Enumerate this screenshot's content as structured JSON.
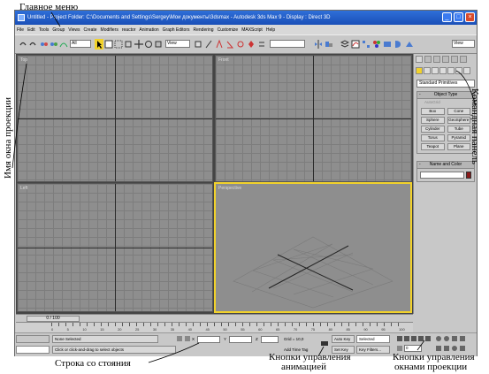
{
  "window": {
    "title": "Untitled   - Project Folder: C:\\Documents and Settings\\Sergey\\Мои документы\\3dsmax   - Autodesk 3ds Max 9   - Display : Direct 3D",
    "minimize": "_",
    "maximize": "□",
    "close": "×"
  },
  "menu": [
    "File",
    "Edit",
    "Tools",
    "Group",
    "Views",
    "Create",
    "Modifiers",
    "reactor",
    "Animation",
    "Graph Editors",
    "Rendering",
    "Customize",
    "MAXScript",
    "Help"
  ],
  "toolbar": {
    "selection_filter": "All",
    "reference_coord": "View",
    "named_selection": "",
    "right_view": "View"
  },
  "viewports": {
    "top_label": "Top",
    "front_label": "Front",
    "left_label": "Left",
    "perspective_label": "Perspective"
  },
  "command_panel": {
    "category": "Standard Primitives",
    "object_type_header": "Object Type",
    "autogrid": "AutoGrid",
    "primitives": [
      "Box",
      "Cone",
      "Sphere",
      "GeoSphere",
      "Cylinder",
      "Tube",
      "Torus",
      "Pyramid",
      "Teapot",
      "Plane"
    ],
    "name_color_header": "Name and Color",
    "collapse_symbol": "-"
  },
  "timeline": {
    "time_slider": "0 / 100",
    "ruler": [
      "0",
      "5",
      "10",
      "15",
      "20",
      "25",
      "30",
      "35",
      "40",
      "45",
      "50",
      "55",
      "60",
      "65",
      "70",
      "75",
      "80",
      "85",
      "90",
      "95",
      "100"
    ]
  },
  "status": {
    "selection": "None Selected",
    "prompt": "Click or click-and-drag to select objects",
    "x_label": "X",
    "y_label": "Y",
    "z_label": "Z",
    "grid": "Grid = 10,0",
    "add_time_tag": "Add Time Tag",
    "auto_key": "Auto Key",
    "auto_key_mode": "Selected",
    "set_key": "Set Key",
    "key_filters": "Key Filters...",
    "frame": "0"
  },
  "annotations": {
    "main_menu": "Главное меню",
    "viewport_name": "Имя окна проекции",
    "command_panel": "Командная панель",
    "status_bar": "Строка со стояния",
    "anim_controls_1": "Кнопки управления",
    "anim_controls_2": "анимацией",
    "vp_controls_1": "Кнопки управления",
    "vp_controls_2": "окнами проекции"
  }
}
